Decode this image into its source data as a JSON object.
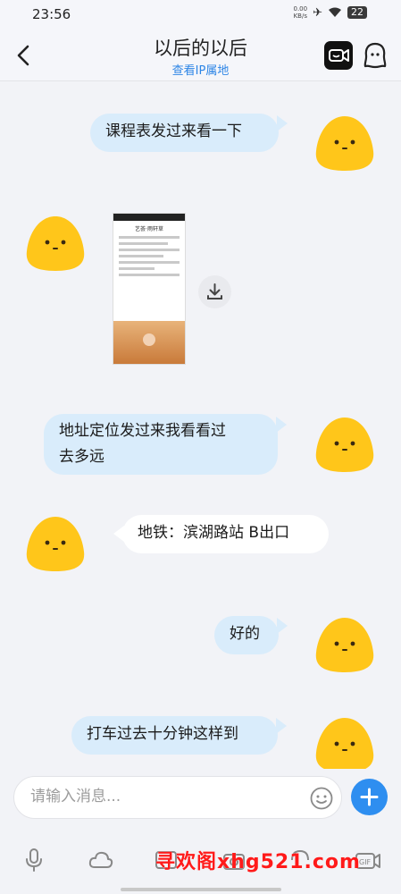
{
  "status_bar": {
    "time": "23:56",
    "net_speed_value": "0.00",
    "net_speed_unit": "KB/s",
    "battery": "22"
  },
  "header": {
    "title": "以后的以后",
    "subtitle": "查看IP属地"
  },
  "messages": [
    {
      "side": "right",
      "text": "课程表发过来看一下"
    },
    {
      "side": "left",
      "type": "image",
      "thumb_caption": "艺荟·雨轩草"
    },
    {
      "side": "right",
      "text_line1": "地址定位发过来我看看过",
      "text_line2": "去多远"
    },
    {
      "side": "left",
      "text": "地铁：滨湖路站 B出口"
    },
    {
      "side": "right",
      "text": "好的"
    },
    {
      "side": "right",
      "text": "打车过去十分钟这样到"
    }
  ],
  "input": {
    "placeholder": "请输入消息..."
  },
  "watermark": "寻欢阁xhg521.com",
  "colors": {
    "accent": "#2e8ef0",
    "bubble_right": "#d9ecfb",
    "avatar": "#ffc61a"
  },
  "icons": [
    "back-arrow-icon",
    "video-call-icon",
    "profile-icon",
    "download-icon",
    "emoji-icon",
    "plus-icon",
    "mic-icon",
    "cloud-icon",
    "gif-icon",
    "camera-icon"
  ]
}
